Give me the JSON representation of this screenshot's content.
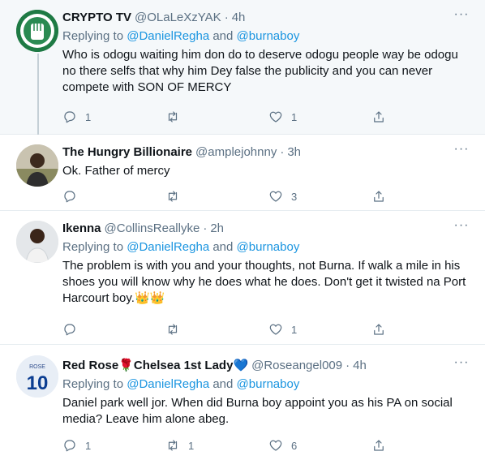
{
  "tweets": [
    {
      "name": "CRYPTO TV",
      "handle": "@OLaLeXzYAK",
      "time": "4h",
      "replying_prefix": "Replying to",
      "mention1": "@DanielRegha",
      "and": "and",
      "mention2": "@burnaboy",
      "text": "Who is odogu waiting him don do to deserve odogu people way be odogu no there selfs that why him Dey false the publicity and you can never compete with SON OF MERCY",
      "replies": "1",
      "retweets": "",
      "likes": "1"
    },
    {
      "name": "The Hungry Billionaire",
      "handle": "@amplejohnny",
      "time": "3h",
      "text": "Ok. Father of mercy",
      "replies": "",
      "retweets": "",
      "likes": "3"
    },
    {
      "name": "Ikenna",
      "handle": "@CollinsReallyke",
      "time": "2h",
      "replying_prefix": "Replying to",
      "mention1": "@DanielRegha",
      "and": "and",
      "mention2": "@burnaboy",
      "text": "The problem is with you and your thoughts, not Burna. If walk a mile in his shoes you will know why he does what he does. Don't get it twisted na Port Harcourt boy.",
      "emoji": "👑👑",
      "replies": "",
      "retweets": "",
      "likes": "1"
    },
    {
      "name_part1": "Red Rose",
      "rose_emoji": "🌹",
      "name_part2": "Chelsea 1st Lady",
      "heart_emoji": "💙",
      "handle": "@Roseangel009",
      "time": "4h",
      "replying_prefix": "Replying to",
      "mention1": "@DanielRegha",
      "and": "and",
      "mention2": "@burnaboy",
      "text": "Daniel park well jor. When did Burna boy appoint you as his PA on social media? Leave him alone abeg.",
      "replies": "1",
      "retweets": "1",
      "likes": "6",
      "avatar_label": "ROSE",
      "avatar_number": "10"
    }
  ],
  "colors": {
    "link": "#1b95e0",
    "secondary": "#5b7083",
    "border": "#e6ecf0"
  }
}
